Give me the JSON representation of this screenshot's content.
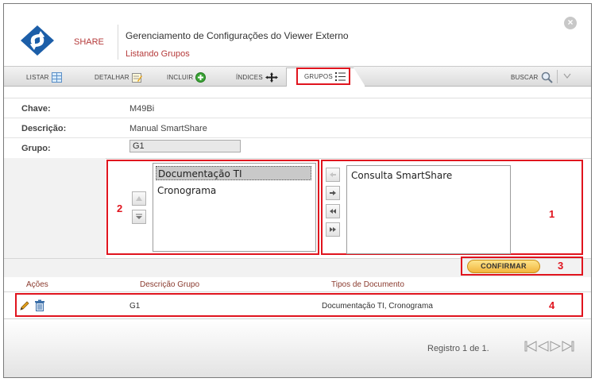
{
  "header": {
    "brand": "SHARE",
    "title": "Gerenciamento de Configurações do Viewer Externo",
    "subtitle": "Listando Grupos",
    "close_symbol": "×"
  },
  "toolbar": {
    "listar": "LISTAR",
    "detalhar": "DETALHAR",
    "incluir": "INCLUIR",
    "indices": "ÍNDICES",
    "grupos": "GRUPOS",
    "buscar": "BUSCAR"
  },
  "form": {
    "chave_label": "Chave:",
    "chave_value": "M49Bi",
    "descricao_label": "Descrição:",
    "descricao_value": "Manual SmartShare",
    "grupo_label": "Grupo:",
    "grupo_value": "G1"
  },
  "selected_list": {
    "items": [
      "Documentação TI",
      "Cronograma"
    ],
    "selected_index": 0
  },
  "available_list": {
    "items": [
      "Consulta SmartShare"
    ]
  },
  "markers": {
    "one": "1",
    "two": "2",
    "three": "3",
    "four": "4"
  },
  "confirm_label": "CONFIRMAR",
  "table": {
    "headers": {
      "acoes": "Ações",
      "descricao": "Descrição Grupo",
      "tipos": "Tipos de Documento"
    },
    "rows": [
      {
        "descricao": "G1",
        "tipos": "Documentação TI, Cronograma"
      }
    ]
  },
  "footer": {
    "registro": "Registro 1 de 1."
  },
  "colors": {
    "accent_red": "#e0141e",
    "brand_red": "#b53a3a",
    "confirm_yellow": "#f2b53d"
  }
}
